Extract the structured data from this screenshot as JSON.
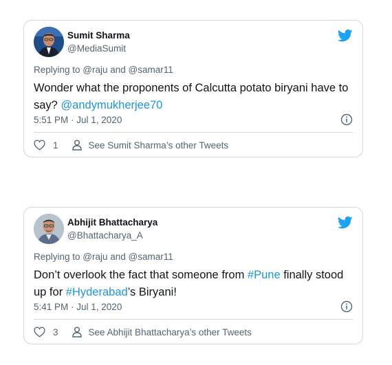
{
  "tweets": [
    {
      "author": {
        "name": "Sumit Sharma",
        "handle": "@MediaSumit"
      },
      "replying": {
        "prefix": "Replying to ",
        "user1": "@raju",
        "and": " and ",
        "user2": "@samar11"
      },
      "body": {
        "text1": "Wonder what the proponents of Calcutta potato biryani have to say? ",
        "mention": "@andymukherjee70"
      },
      "timestamp": "5:51 PM · Jul 1, 2020",
      "likes": "1",
      "other_tweets": "See Sumit Sharma’s other Tweets"
    },
    {
      "author": {
        "name": "Abhijit Bhattacharya",
        "handle": "@Bhattacharya_A"
      },
      "replying": {
        "prefix": "Replying to ",
        "user1": "@raju",
        "and": " and ",
        "user2": "@samar11"
      },
      "body": {
        "text1": "Don’t overlook the fact that someone from ",
        "hashtag1": "#Pune",
        "text2": " finally stood up for ",
        "hashtag2": "#Hyderabad",
        "text3": "’s Biryani!"
      },
      "timestamp": "5:41 PM · Jul 1, 2020",
      "likes": "3",
      "other_tweets": "See Abhijit Bhattacharya’s other Tweets"
    }
  ],
  "icons": {
    "brand": "twitter-bird-icon",
    "info": "info-icon",
    "like": "heart-icon",
    "profile": "person-icon"
  },
  "colors": {
    "twitter_blue": "#1da1f2",
    "link": "#1b95e0",
    "text_primary": "#0f1419",
    "text_secondary": "#536471",
    "border": "#cfd9de"
  }
}
